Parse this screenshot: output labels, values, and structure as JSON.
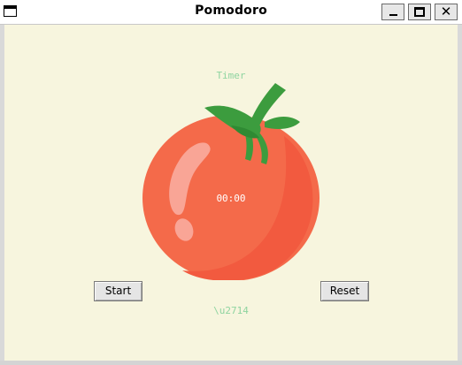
{
  "window": {
    "title": "Pomodoro",
    "close_glyph": "✕"
  },
  "timer": {
    "label": "Timer",
    "time": "00:00",
    "checkmarks": "\\u2714"
  },
  "buttons": {
    "start_label": "Start",
    "reset_label": "Reset"
  },
  "colors": {
    "background": "#f7f5de",
    "label_green": "#8fd4a0",
    "tomato_red": "#f46a4a",
    "stem_green": "#3c9c3e"
  },
  "icons": {
    "tomato": "tomato-image"
  }
}
